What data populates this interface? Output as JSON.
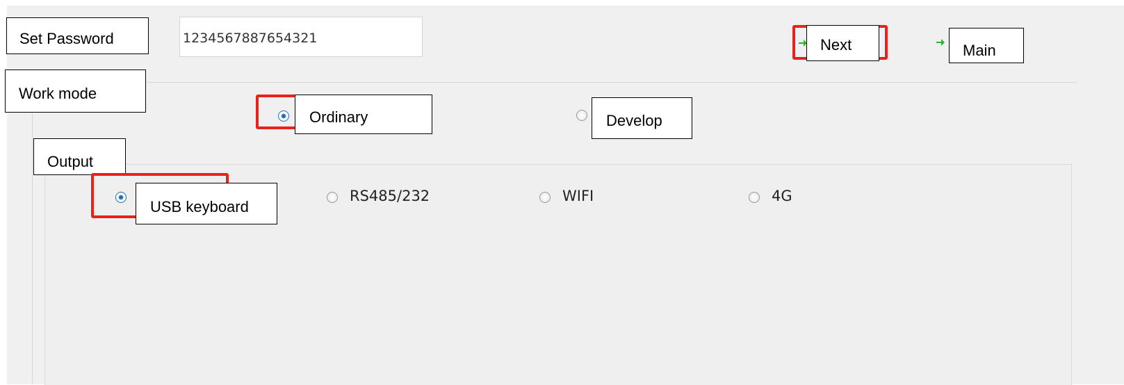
{
  "header": {
    "set_password_label": "Set Password",
    "password_value": "1234567887654321",
    "next_label": "Next",
    "main_label": "Main"
  },
  "work_mode": {
    "label": "Work mode",
    "options": [
      "Ordinary",
      "Develop"
    ],
    "selected": "Ordinary"
  },
  "output": {
    "label": "Output",
    "options": [
      "USB keyboard",
      "RS485/232",
      "WIFI",
      "4G"
    ],
    "selected": "USB keyboard"
  },
  "colors": {
    "highlight": "#e8211a",
    "panel": "#f0f0f0",
    "arrow": "#2db52d"
  },
  "icons": {
    "next": "arrow-right-icon",
    "main": "arrow-right-icon"
  }
}
